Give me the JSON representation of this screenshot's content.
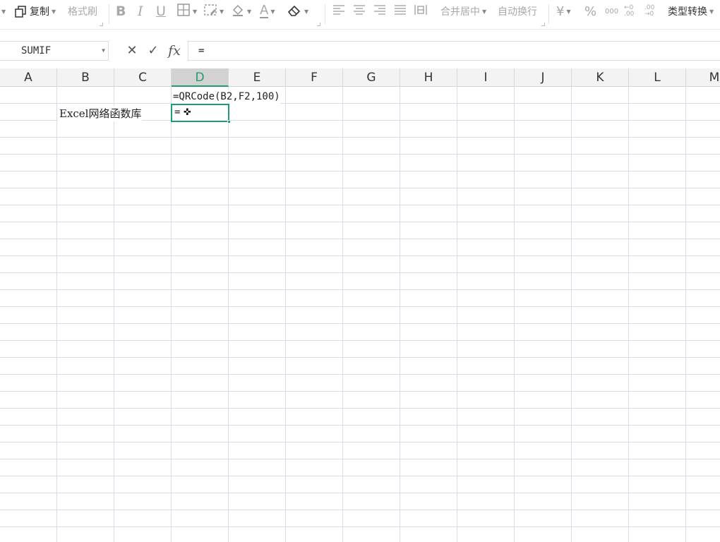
{
  "toolbar": {
    "copy_label": "复制",
    "format_painter_label": "格式刷",
    "bold_label": "B",
    "italic_label": "I",
    "underline_label": "U",
    "font_color_label": "A",
    "merge_center_label": "合并居中",
    "wrap_text_label": "自动换行",
    "currency_label": "¥",
    "percent_label": "%",
    "thousands_label": "000",
    "decimal_increase_label": "←0 .00",
    "decimal_decrease_label": ".00 →0",
    "type_convert_label": "类型转换"
  },
  "formula_bar": {
    "name_box": "SUMIF",
    "cancel": "✕",
    "confirm": "✓",
    "fx": "fx",
    "content": "="
  },
  "columns": [
    "A",
    "B",
    "C",
    "D",
    "E",
    "F",
    "G",
    "H",
    "I",
    "J",
    "K",
    "L",
    "M"
  ],
  "active_column": "D",
  "cells": {
    "D1": "=QRCode(B2,F2,100)",
    "B2": "Excel网络函数库",
    "D2": "="
  },
  "colors": {
    "accent": "#1e9e6b",
    "gridline": "#d8dce6",
    "header_bg": "#f3f3f3"
  }
}
